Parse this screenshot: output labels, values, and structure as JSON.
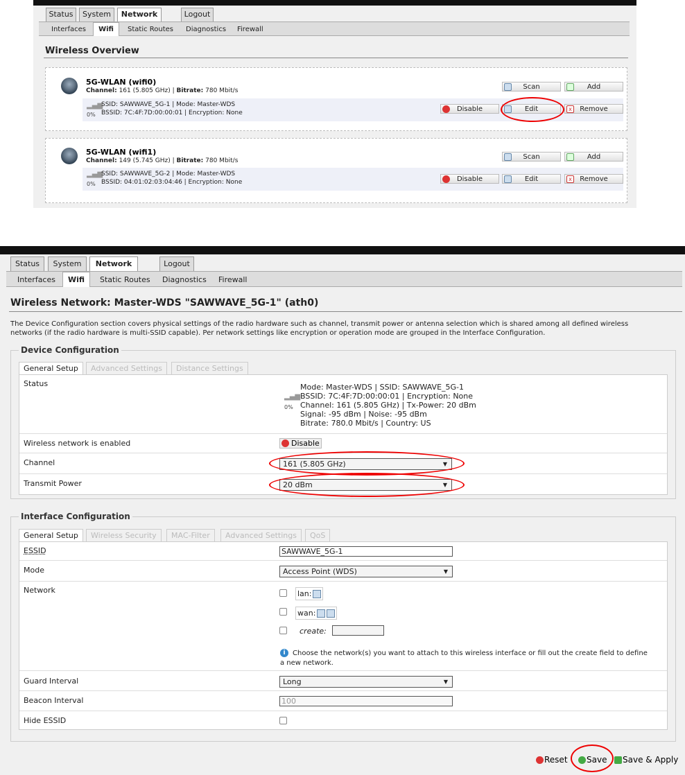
{
  "top": {
    "tabs": [
      "Status",
      "System",
      "Network",
      "Logout"
    ],
    "subnav": [
      "Interfaces",
      "Wifi",
      "Static Routes",
      "Diagnostics",
      "Firewall"
    ],
    "page_title": "Wireless Overview",
    "radios": [
      {
        "title": "5G-WLAN (wifi0)",
        "channel_label": "Channel:",
        "channel_value": "161 (5.805 GHz)",
        "bitrate_label": "Bitrate:",
        "bitrate_value": "780 Mbit/s",
        "ssid_line": "SSID: SAWWAVE_5G-1 | Mode: Master-WDS",
        "bssid_line": "BSSID: 7C:4F:7D:00:00:01 | Encryption: None",
        "signal": "0%",
        "buttons": {
          "scan": "Scan",
          "add": "Add",
          "disable": "Disable",
          "edit": "Edit",
          "remove": "Remove"
        }
      },
      {
        "title": "5G-WLAN (wifi1)",
        "channel_label": "Channel:",
        "channel_value": "149 (5.745 GHz)",
        "bitrate_label": "Bitrate:",
        "bitrate_value": "780 Mbit/s",
        "ssid_line": "SSID: SAWWAVE_5G-2 | Mode: Master-WDS",
        "bssid_line": "BSSID: 04:01:02:03:04:46 | Encryption: None",
        "signal": "0%",
        "buttons": {
          "scan": "Scan",
          "add": "Add",
          "disable": "Disable",
          "edit": "Edit",
          "remove": "Remove"
        }
      }
    ]
  },
  "bottom": {
    "tabs": [
      "Status",
      "System",
      "Network",
      "Logout"
    ],
    "subnav": [
      "Interfaces",
      "Wifi",
      "Static Routes",
      "Diagnostics",
      "Firewall"
    ],
    "page_title": "Wireless Network: Master-WDS \"SAWWAVE_5G-1\" (ath0)",
    "description_line1": "The Device Configuration section covers physical settings of the radio hardware such as channel, transmit power or antenna selection which is shared among all defined wireless",
    "description_line2": "networks (if the radio hardware is multi-SSID capable). Per network settings like encryption or operation mode are grouped in the Interface Configuration.",
    "device_config": {
      "legend": "Device Configuration",
      "tabs": [
        "General Setup",
        "Advanced Settings",
        "Distance Settings"
      ],
      "status_label": "Status",
      "status_lines": [
        "Mode: Master-WDS | SSID: SAWWAVE_5G-1",
        "BSSID: 7C:4F:7D:00:00:01 | Encryption: None",
        "Channel: 161 (5.805 GHz) | Tx-Power: 20 dBm",
        "Signal: -95 dBm | Noise: -95 dBm",
        "Bitrate: 780.0 Mbit/s | Country: US"
      ],
      "signal": "0%",
      "enabled_label": "Wireless network is enabled",
      "disable_button": "Disable",
      "channel_label": "Channel",
      "channel_value": "161 (5.805 GHz)",
      "txpower_label": "Transmit Power",
      "txpower_value": "20 dBm"
    },
    "iface_config": {
      "legend": "Interface Configuration",
      "tabs": [
        "General Setup",
        "Wireless Security",
        "MAC-Filter",
        "Advanced Settings",
        "QoS"
      ],
      "essid_label": "ESSID",
      "essid_value": "SAWWAVE_5G-1",
      "mode_label": "Mode",
      "mode_value": "Access Point (WDS)",
      "network_label": "Network",
      "net_lan": "lan:",
      "net_wan": "wan:",
      "net_create": "create:",
      "help_line1": "Choose the network(s) you want to attach to this wireless interface or fill out the create field to define",
      "help_line2": "a new network.",
      "guard_label": "Guard Interval",
      "guard_value": "Long",
      "beacon_label": "Beacon Interval",
      "beacon_placeholder": "100",
      "hide_label": "Hide ESSID"
    },
    "actions": {
      "reset": "Reset",
      "save": "Save",
      "save_apply": "Save & Apply"
    }
  }
}
